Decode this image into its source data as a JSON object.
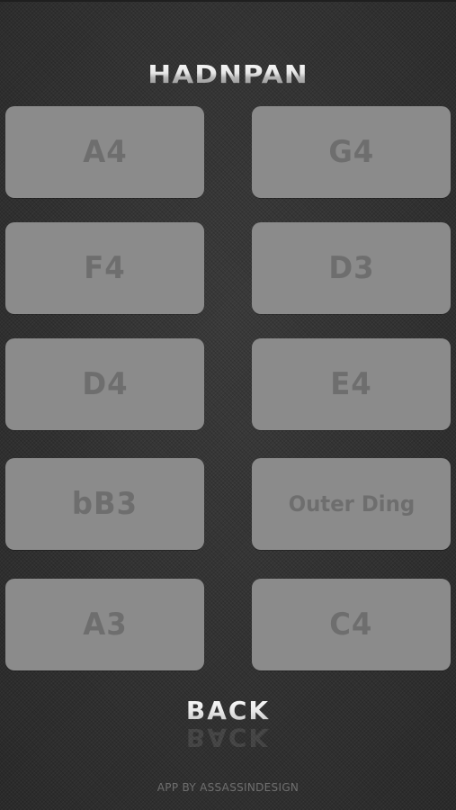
{
  "app": {
    "title": "HADNPAN"
  },
  "pads": [
    {
      "label": "A4"
    },
    {
      "label": "G4"
    },
    {
      "label": "F4"
    },
    {
      "label": "D3"
    },
    {
      "label": "D4"
    },
    {
      "label": "E4"
    },
    {
      "label": "bB3"
    },
    {
      "label": "Outer Ding"
    },
    {
      "label": "A3"
    },
    {
      "label": "C4"
    }
  ],
  "nav": {
    "back_label": "BACK"
  },
  "footer": {
    "credit": "APP BY ASSASSINDESIGN"
  },
  "colors": {
    "background": "#333333",
    "pad_fill": "#8b8b8b",
    "pad_text": "#6e6e6e",
    "title_text": "#e6e6e6",
    "footer_text": "#6f6f6f"
  }
}
